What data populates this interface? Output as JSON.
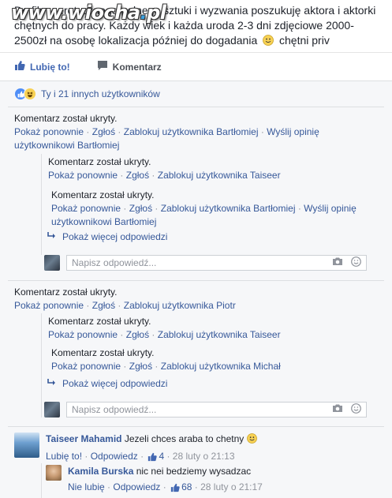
{
  "post": {
    "text": "Do filmu erotycznego pełnego sztuki i wyzwania poszukuję aktora i aktorki chętnych do pracy. Każdy wiek i każda uroda 2-3 dni zdjęciowe 2000-2500zł na osobę lokalizacja później do dogadania",
    "emoji_text": "chętni priv"
  },
  "watermark": {
    "left": "www.wiocha",
    "dot": ".",
    "right": "pl"
  },
  "actions": {
    "like_label": "Lubię to!",
    "comment_label": "Komentarz"
  },
  "likes": {
    "text": "Ty i 21 innych użytkowników"
  },
  "hidden_blocks": [
    {
      "head": "Komentarz został ukryty.",
      "links": [
        "Pokaż ponownie",
        "Zgłoś",
        "Zablokuj użytkownika Bartłomiej",
        "Wyślij opinię użytkownikowi Bartłomiej"
      ]
    },
    {
      "head": "Komentarz został ukryty.",
      "links": [
        "Pokaż ponownie",
        "Zgłoś",
        "Zablokuj użytkownika Taiseer"
      ]
    },
    {
      "head": "Komentarz został ukryty.",
      "links": [
        "Pokaż ponownie",
        "Zgłoś",
        "Zablokuj użytkownika Bartłomiej",
        "Wyślij opinię użytkownikowi Bartłomiej"
      ]
    },
    {
      "head": "Komentarz został ukryty.",
      "links": [
        "Pokaż ponownie",
        "Zgłoś",
        "Zablokuj użytkownika Piotr"
      ]
    },
    {
      "head": "Komentarz został ukryty.",
      "links": [
        "Pokaż ponownie",
        "Zgłoś",
        "Zablokuj użytkownika Taiseer"
      ]
    },
    {
      "head": "Komentarz został ukryty.",
      "links": [
        "Pokaż ponownie",
        "Zgłoś",
        "Zablokuj użytkownika Michał"
      ]
    }
  ],
  "more_replies": "Pokaż więcej odpowiedzi",
  "reply_placeholder": "Napisz odpowiedź...",
  "comments": [
    {
      "name": "Taiseer Mahamid",
      "text": "Jezeli chces araba to chetny",
      "like": "Lubię to!",
      "reply": "Odpowiedz",
      "likes": "4",
      "time": "28 luty o 21:13"
    },
    {
      "name": "Kamila Burska",
      "text": "nic nei bedziemy wysadzac",
      "like": "Nie lubię",
      "reply": "Odpowiedz",
      "likes": "68",
      "time": "28 luty o 21:17"
    }
  ],
  "colors": {
    "link": "#365899",
    "like_blue": "#4267b2",
    "bg": "#f6f7f9"
  }
}
